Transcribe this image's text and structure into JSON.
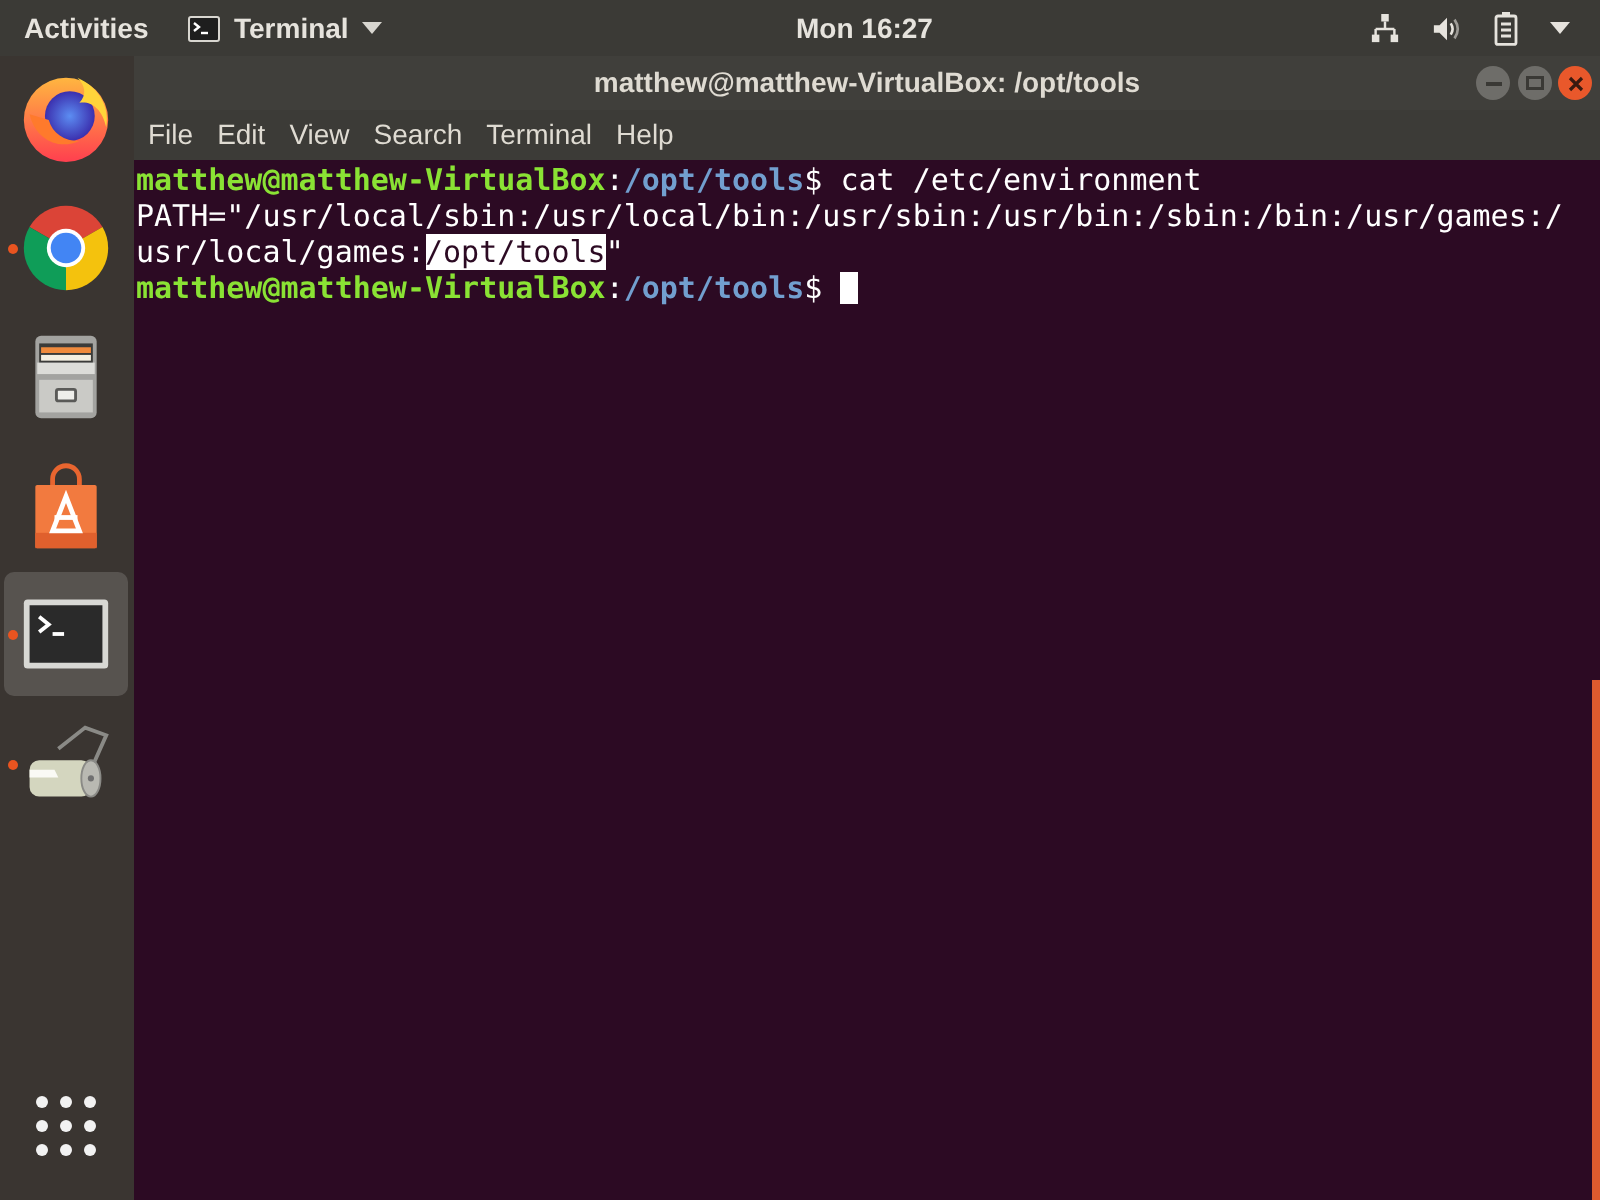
{
  "top_bar": {
    "activities": "Activities",
    "app_menu": "Terminal",
    "clock": "Mon 16:27"
  },
  "dock": {
    "items": [
      {
        "kind": "fox",
        "running": false,
        "selected": false
      },
      {
        "kind": "browser",
        "running": true,
        "selected": false
      },
      {
        "kind": "cabinet",
        "running": false,
        "selected": false
      },
      {
        "kind": "bag",
        "running": false,
        "selected": false
      },
      {
        "kind": "terminal",
        "running": true,
        "selected": true
      },
      {
        "kind": "roller",
        "running": true,
        "selected": false
      }
    ]
  },
  "window": {
    "title": "matthew@matthew-VirtualBox: /opt/tools",
    "menu": [
      "File",
      "Edit",
      "View",
      "Search",
      "Terminal",
      "Help"
    ]
  },
  "terminal": {
    "lines": [
      {
        "cursor": false,
        "segments": [
          {
            "kind": "user",
            "text": "matthew@matthew-VirtualBox",
            "selected": false
          },
          {
            "kind": "plain",
            "text": ":",
            "selected": false
          },
          {
            "kind": "path",
            "text": "/opt/tools",
            "selected": false
          },
          {
            "kind": "plain",
            "text": "$ cat /etc/environment",
            "selected": false
          }
        ]
      },
      {
        "cursor": false,
        "segments": [
          {
            "kind": "plain",
            "text": "PATH=\"/usr/local/sbin:/usr/local/bin:/usr/sbin:/usr/bin:/sbin:/bin:/usr/games:/",
            "selected": false
          }
        ]
      },
      {
        "cursor": false,
        "segments": [
          {
            "kind": "plain",
            "text": "usr/local/games:",
            "selected": false
          },
          {
            "kind": "plain",
            "text": "/opt/tools",
            "selected": true
          },
          {
            "kind": "plain",
            "text": "\"",
            "selected": false
          }
        ]
      },
      {
        "cursor": true,
        "segments": [
          {
            "kind": "user",
            "text": "matthew@matthew-VirtualBox",
            "selected": false
          },
          {
            "kind": "plain",
            "text": ":",
            "selected": false
          },
          {
            "kind": "path",
            "text": "/opt/tools",
            "selected": false
          },
          {
            "kind": "plain",
            "text": "$ ",
            "selected": false
          }
        ]
      }
    ]
  }
}
